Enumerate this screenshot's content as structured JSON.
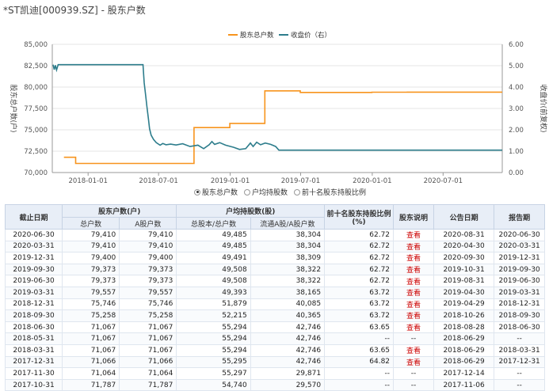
{
  "page": {
    "title": "*ST凯迪[000939.SZ] - 股东户数"
  },
  "colors": {
    "orange": "#f7941d",
    "teal": "#2d7d8c",
    "grid": "#e5e5e5",
    "axis": "#999999"
  },
  "radio": {
    "options": [
      "股东总户数",
      "户均持股数",
      "前十名股东持股比例"
    ],
    "selected": 0
  },
  "chart_data": {
    "type": "line",
    "ylabel": "股东总户数(户)",
    "y2label": "收盘价(前复权)",
    "ylim": [
      70000,
      85000
    ],
    "y2lim": [
      0,
      6
    ],
    "yticks": [
      "70,000",
      "72,500",
      "75,000",
      "77,500",
      "80,000",
      "82,500",
      "85,000"
    ],
    "y2ticks": [
      "0.00",
      "1.00",
      "2.00",
      "3.00",
      "4.00",
      "5.00",
      "6.00"
    ],
    "xticks": [
      "2018-01-01",
      "2018-07-01",
      "2019-01-01",
      "2019-07-01",
      "2020-01-01",
      "2020-07-01"
    ],
    "xrange": [
      "2017-10-01",
      "2020-11-30"
    ],
    "series": [
      {
        "name": "股东总户数",
        "axis": "left",
        "step": true,
        "points": [
          [
            "2017-10-31",
            71787
          ],
          [
            "2017-11-30",
            71064
          ],
          [
            "2017-12-31",
            71066
          ],
          [
            "2018-03-31",
            71067
          ],
          [
            "2018-05-31",
            71067
          ],
          [
            "2018-06-30",
            71067
          ],
          [
            "2018-09-30",
            75258
          ],
          [
            "2018-12-31",
            75746
          ],
          [
            "2019-03-31",
            79557
          ],
          [
            "2019-06-30",
            79373
          ],
          [
            "2019-09-30",
            79373
          ],
          [
            "2019-12-31",
            79400
          ],
          [
            "2020-03-31",
            79410
          ],
          [
            "2020-06-30",
            79410
          ],
          [
            "2020-11-30",
            79410
          ]
        ]
      },
      {
        "name": "收盘价（右）",
        "axis": "right",
        "step": false,
        "points": [
          [
            "2017-10-03",
            5.05
          ],
          [
            "2017-10-06",
            4.82
          ],
          [
            "2017-10-09",
            5.02
          ],
          [
            "2017-10-12",
            4.8
          ],
          [
            "2017-10-16",
            5.05
          ],
          [
            "2017-11-01",
            5.05
          ],
          [
            "2018-01-01",
            5.05
          ],
          [
            "2018-04-01",
            5.05
          ],
          [
            "2018-05-22",
            5.05
          ],
          [
            "2018-05-25",
            4.2
          ],
          [
            "2018-05-29",
            3.6
          ],
          [
            "2018-06-01",
            3.1
          ],
          [
            "2018-06-05",
            2.5
          ],
          [
            "2018-06-08",
            2.05
          ],
          [
            "2018-06-12",
            1.75
          ],
          [
            "2018-06-18",
            1.55
          ],
          [
            "2018-06-25",
            1.4
          ],
          [
            "2018-07-05",
            1.28
          ],
          [
            "2018-07-12",
            1.36
          ],
          [
            "2018-07-20",
            1.3
          ],
          [
            "2018-08-01",
            1.33
          ],
          [
            "2018-08-15",
            1.29
          ],
          [
            "2018-09-01",
            1.35
          ],
          [
            "2018-09-20",
            1.22
          ],
          [
            "2018-10-10",
            1.28
          ],
          [
            "2018-10-25",
            1.12
          ],
          [
            "2018-11-08",
            1.3
          ],
          [
            "2018-11-15",
            1.45
          ],
          [
            "2018-11-22",
            1.32
          ],
          [
            "2018-12-05",
            1.4
          ],
          [
            "2018-12-20",
            1.28
          ],
          [
            "2019-01-10",
            1.18
          ],
          [
            "2019-01-25",
            1.08
          ],
          [
            "2019-02-10",
            1.12
          ],
          [
            "2019-02-22",
            1.38
          ],
          [
            "2019-03-01",
            1.22
          ],
          [
            "2019-03-10",
            1.42
          ],
          [
            "2019-03-20",
            1.3
          ],
          [
            "2019-04-01",
            1.38
          ],
          [
            "2019-04-15",
            1.32
          ],
          [
            "2019-04-28",
            1.22
          ],
          [
            "2019-05-06",
            1.05
          ],
          [
            "2019-06-01",
            1.05
          ],
          [
            "2020-01-01",
            1.05
          ],
          [
            "2020-11-30",
            1.05
          ]
        ]
      }
    ]
  },
  "table": {
    "group_headers": [
      "截止日期",
      "股东户数(户)",
      "户均持股数(股)",
      "前十名股东持股比例(%)",
      "股东说明",
      "公告日期",
      "报告期"
    ],
    "sub_headers": [
      "总户数",
      "A股户数",
      "总股本/总户数",
      "流通A股/A股户数"
    ],
    "rows": [
      [
        "2020-06-30",
        "79,410",
        "79,410",
        "49,485",
        "38,304",
        "62.72",
        "查看",
        "2020-08-31",
        "2020-06-30"
      ],
      [
        "2020-03-31",
        "79,410",
        "79,410",
        "49,485",
        "38,304",
        "62.72",
        "查看",
        "2020-04-30",
        "2020-03-31"
      ],
      [
        "2019-12-31",
        "79,400",
        "79,400",
        "49,491",
        "38,309",
        "62.72",
        "查看",
        "2020-09-30",
        "2019-12-31"
      ],
      [
        "2019-09-30",
        "79,373",
        "79,373",
        "49,508",
        "38,322",
        "62.72",
        "查看",
        "2019-10-31",
        "2019-09-30"
      ],
      [
        "2019-06-30",
        "79,373",
        "79,373",
        "49,508",
        "38,322",
        "62.72",
        "查看",
        "2019-08-31",
        "2019-06-30"
      ],
      [
        "2019-03-31",
        "79,557",
        "79,557",
        "49,393",
        "38,165",
        "63.72",
        "查看",
        "2019-04-30",
        "2019-03-31"
      ],
      [
        "2018-12-31",
        "75,746",
        "75,746",
        "51,879",
        "40,085",
        "63.72",
        "查看",
        "2019-04-29",
        "2018-12-31"
      ],
      [
        "2018-09-30",
        "75,258",
        "75,258",
        "52,215",
        "40,365",
        "63.72",
        "查看",
        "2018-10-26",
        "2018-09-30"
      ],
      [
        "2018-06-30",
        "71,067",
        "71,067",
        "55,294",
        "42,746",
        "63.65",
        "查看",
        "2018-08-28",
        "2018-06-30"
      ],
      [
        "2018-05-31",
        "71,067",
        "71,067",
        "55,294",
        "42,746",
        "--",
        "--",
        "2018-06-29",
        "--"
      ],
      [
        "2018-03-31",
        "71,067",
        "71,067",
        "55,294",
        "42,746",
        "63.65",
        "查看",
        "2018-06-29",
        "2018-03-31"
      ],
      [
        "2017-12-31",
        "71,066",
        "71,066",
        "55,295",
        "42,746",
        "64.82",
        "查看",
        "2018-06-29",
        "2017-12-31"
      ],
      [
        "2017-11-30",
        "71,064",
        "71,064",
        "55,297",
        "29,871",
        "--",
        "--",
        "2017-12-14",
        "--"
      ],
      [
        "2017-10-31",
        "71,787",
        "71,787",
        "54,740",
        "29,570",
        "--",
        "--",
        "2017-11-06",
        "--"
      ]
    ]
  }
}
